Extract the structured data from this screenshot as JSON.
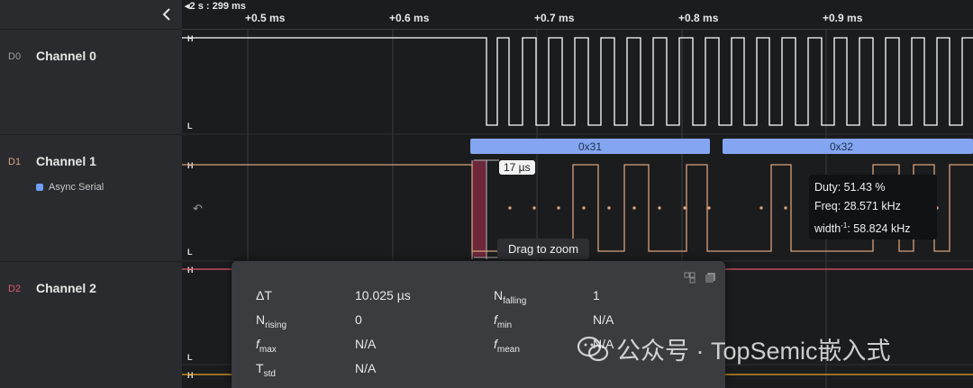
{
  "ruler": {
    "origin_label": "◂2 s : 299 ms",
    "ticks": [
      "+0.5 ms",
      "+0.6 ms",
      "+0.7 ms",
      "+0.8 ms",
      "+0.9 ms"
    ]
  },
  "channels": [
    {
      "tag": "D0",
      "name": "Channel 0",
      "color": "#ffffff"
    },
    {
      "tag": "D1",
      "name": "Channel 1",
      "color": "#d9a27a",
      "analyzer": "Async Serial"
    },
    {
      "tag": "D2",
      "name": "Channel 2",
      "color": "#e2566a"
    }
  ],
  "level_labels": {
    "high": "H",
    "low": "L"
  },
  "protocol_frames": [
    "0x31",
    "0x32"
  ],
  "marker": {
    "width_label": "17 µs",
    "hint": "Drag to zoom"
  },
  "measurement_tooltip": {
    "duty": "Duty: 51.43 %",
    "freq": "Freq: 28.571 kHz",
    "width_prefix": "width",
    "width_value": ": 58.824 kHz"
  },
  "measure_panel": {
    "delta_t": {
      "label": "ΔT",
      "value": "10.025 µs"
    },
    "n_falling": {
      "label": "N",
      "sub": "falling",
      "value": "1"
    },
    "n_rising": {
      "label": "N",
      "sub": "rising",
      "value": "0"
    },
    "f_min": {
      "label": "f",
      "sub": "min",
      "value": "N/A"
    },
    "f_max": {
      "label": "f",
      "sub": "max",
      "value": "N/A"
    },
    "f_mean": {
      "label": "f",
      "sub": "mean",
      "value": "N/A"
    },
    "t_std": {
      "label": "T",
      "sub": "std",
      "value": "N/A"
    }
  },
  "watermark": "公众号 · TopSemic嵌入式",
  "colors": {
    "background": "#1b1c1e",
    "sidebar": "#2a2b2e",
    "frame_bar": "#84a6f2",
    "panel": "#3b3c40"
  }
}
